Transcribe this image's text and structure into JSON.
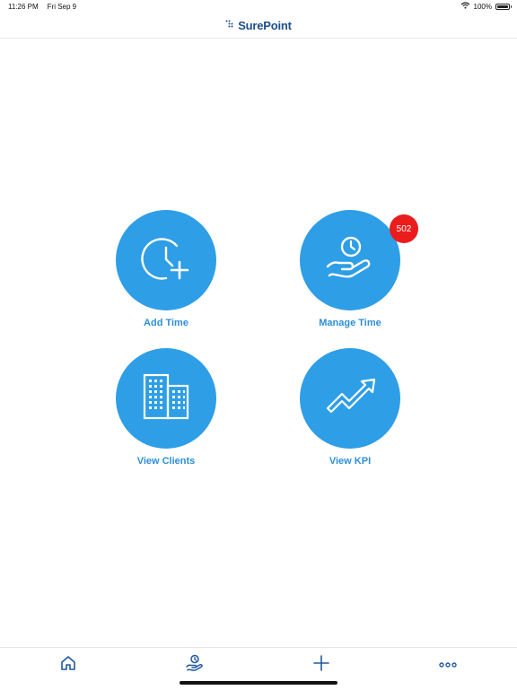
{
  "status_bar": {
    "time": "11:26 PM",
    "date": "Fri Sep 9",
    "battery": "100%"
  },
  "header": {
    "logo_text": "SurePoint"
  },
  "tiles": [
    {
      "label": "Add Time",
      "icon": "clock-plus-icon"
    },
    {
      "label": "Manage Time",
      "icon": "hand-clock-icon",
      "badge": "502"
    },
    {
      "label": "View Clients",
      "icon": "buildings-icon"
    },
    {
      "label": "View KPI",
      "icon": "trending-up-icon"
    }
  ],
  "tab_bar": {
    "items": [
      {
        "icon": "home-icon"
      },
      {
        "icon": "hand-clock-icon"
      },
      {
        "icon": "plus-icon"
      },
      {
        "icon": "more-icon"
      }
    ]
  },
  "colors": {
    "accent": "#2e9ee6",
    "label": "#2e8fd6",
    "badge": "#ea1c1c",
    "tab_icon": "#1f5a9e",
    "logo": "#1c4f8e"
  }
}
